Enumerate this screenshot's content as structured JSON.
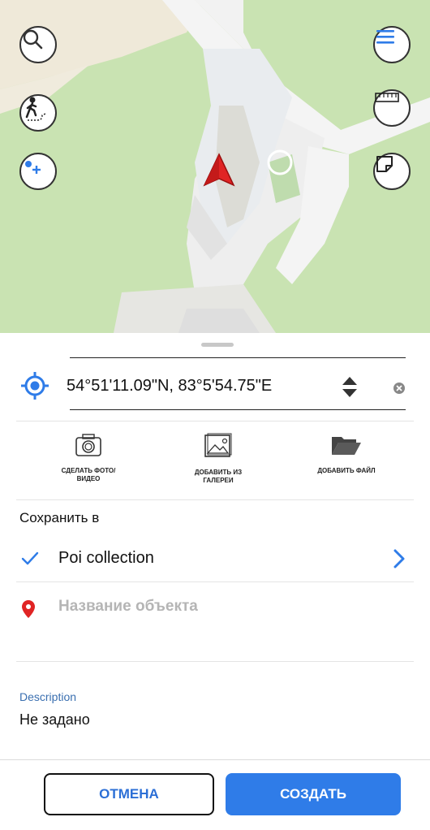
{
  "colors": {
    "accent": "#2f7ce8",
    "map_green": "#c9e3b2",
    "road": "#f4f4f4",
    "marker_red": "#e02424",
    "link_blue": "#3a6fb0"
  },
  "map": {
    "buttons": {
      "search": "search-icon",
      "menu": "menu-icon",
      "route": "pedestrian-route-icon",
      "ruler": "ruler-icon",
      "add_point": "add-point-icon",
      "note": "note-icon"
    },
    "marker": "location-arrow-icon"
  },
  "sheet": {
    "coordinates": "54°51'11.09\"N, 83°5'54.75\"E",
    "actions": [
      {
        "label": "СДЕЛАТЬ ФОТО/\nВИДЕО",
        "icon": "camera-icon"
      },
      {
        "label": "ДОБАВИТЬ ИЗ\nГАЛЕРЕИ",
        "icon": "gallery-icon"
      },
      {
        "label": "ДОБАВИТЬ ФАЙЛ",
        "icon": "folder-icon"
      }
    ],
    "save_in_label": "Сохранить в",
    "collection_name": "Poi collection",
    "name_placeholder": "Название объекта",
    "description_label": "Description",
    "description_value": "Не задано"
  },
  "buttons": {
    "cancel": "ОТМЕНА",
    "create": "СОЗДАТЬ"
  }
}
